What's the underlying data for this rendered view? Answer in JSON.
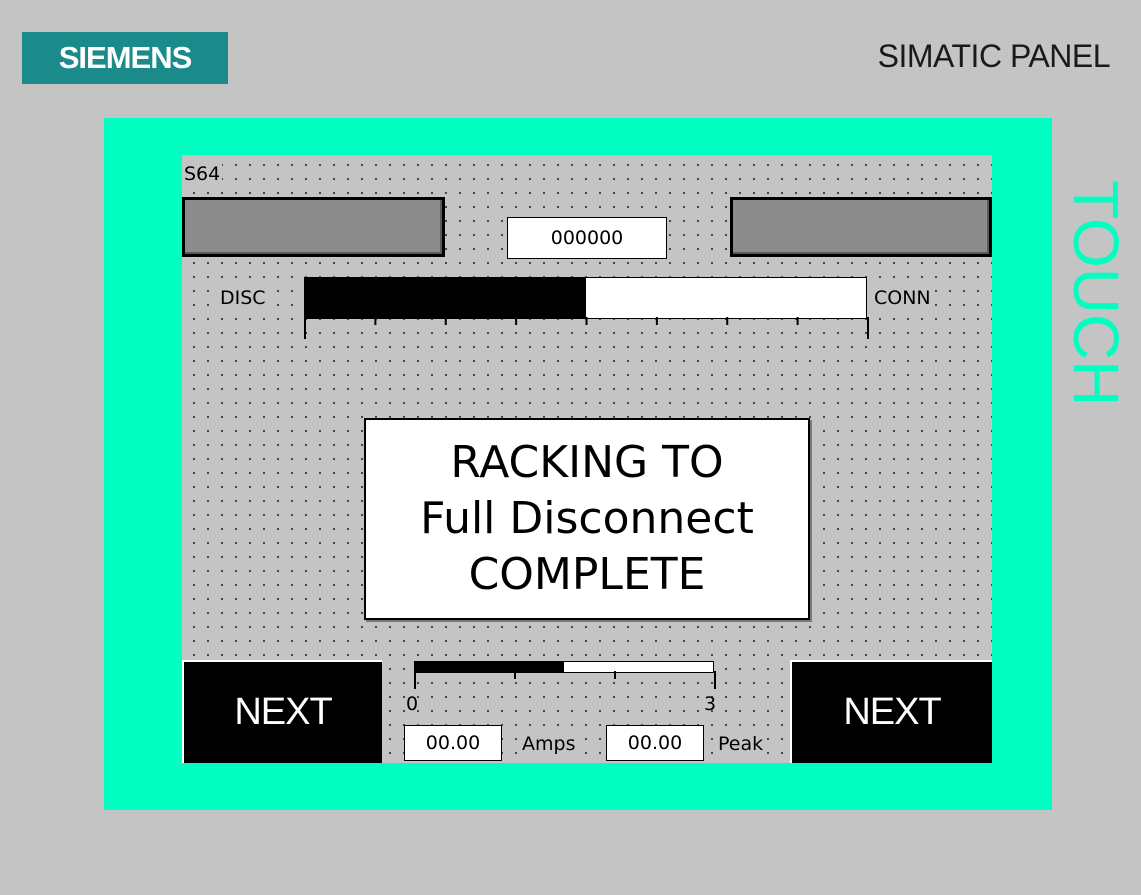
{
  "housing": {
    "brand": "SIEMENS",
    "panel_title": "SIMATIC PANEL",
    "side_label": "TOUCH",
    "colors": {
      "housing": "#c4c4c4",
      "bezel": "#00ffc0",
      "brand_bg": "#1a8a8a",
      "screen_bg": "#c4c4c4"
    }
  },
  "screen": {
    "station_id": "S64",
    "counter_value": "000000",
    "position_indicator": {
      "left_label": "DISC",
      "right_label": "CONN",
      "fill_fraction": 0.5,
      "tick_count": 9
    },
    "status_message": {
      "line1": "RACKING TO",
      "line2": "Full Disconnect",
      "line3": "COMPLETE"
    },
    "left_button_label": "NEXT",
    "right_button_label": "NEXT",
    "current_gauge": {
      "min_label": "0",
      "max_label": "3",
      "fill_fraction": 0.5,
      "tick_count": 4
    },
    "amps_value": "00.00",
    "amps_label": "Amps",
    "peak_value": "00.00",
    "peak_label": "Peak"
  }
}
